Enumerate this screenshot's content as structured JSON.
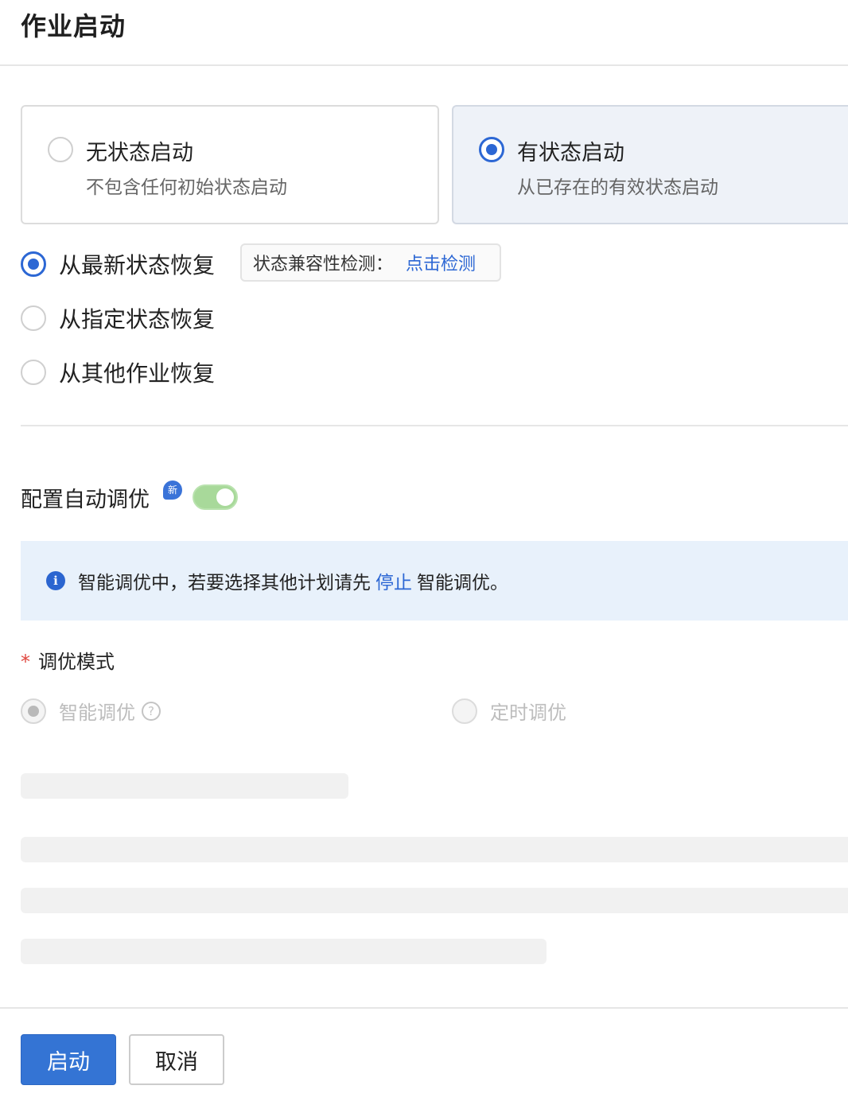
{
  "page_title": "作业启动",
  "start_mode": {
    "cards": [
      {
        "title": "无状态启动",
        "desc": "不包含任何初始状态启动",
        "selected": false
      },
      {
        "title": "有状态启动",
        "desc": "从已存在的有效状态启动",
        "selected": true
      }
    ]
  },
  "restore": {
    "options": [
      {
        "label": "从最新状态恢复",
        "selected": true
      },
      {
        "label": "从指定状态恢复",
        "selected": false
      },
      {
        "label": "从其他作业恢复",
        "selected": false
      }
    ],
    "compat_check": {
      "label": "状态兼容性检测：",
      "link": "点击检测"
    }
  },
  "auto_tune": {
    "label": "配置自动调优",
    "badge": "新",
    "enabled": true
  },
  "info_banner": {
    "icon": "info-icon",
    "text_before": "智能调优中，若要选择其他计划请先",
    "link": "停止",
    "text_after": "智能调优。"
  },
  "tune_mode": {
    "required_mark": "*",
    "label": "调优模式",
    "options": [
      {
        "label": "智能调优",
        "selected": true,
        "disabled": true,
        "help_icon": "question-icon"
      },
      {
        "label": "定时调优",
        "selected": false,
        "disabled": true
      }
    ]
  },
  "footer": {
    "primary_label": "启动",
    "cancel_label": "取消"
  },
  "colors": {
    "accent": "#2c67d4",
    "info_bg": "#e8f1fb",
    "toggle_on": "#a8d99a",
    "required": "#e0463e"
  }
}
